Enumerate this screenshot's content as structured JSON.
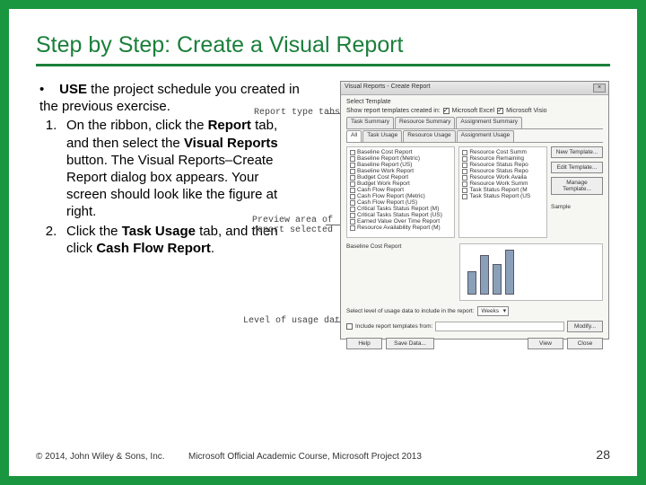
{
  "title": "Step by Step: Create a Visual Report",
  "use_line": {
    "bullet": "•",
    "emph": "USE",
    "rest": " the project schedule you created in the previous exercise."
  },
  "steps": [
    {
      "num": "1.",
      "parts": {
        "a": "On the ribbon, click the ",
        "b": "Report",
        "c": " tab, and then select the ",
        "d": "Visual Reports",
        "e": " button. The Visual Reports–Create Report dialog box appears. Your screen should look like the figure at right."
      }
    },
    {
      "num": "2.",
      "parts": {
        "a": "Click the ",
        "b": "Task Usage",
        "c": " tab, and then click ",
        "d": "Cash Flow Report",
        "e": "."
      }
    }
  ],
  "callouts": {
    "tabs": "Report type tabs",
    "preview": "Preview area of\nreport selected",
    "level": "Level of usage data"
  },
  "dialog": {
    "title": "Visual Reports - Create Report",
    "select_template": "Select Template",
    "show_line": "Show report templates created in:",
    "show_opts": [
      "Microsoft Excel",
      "Microsoft Visio"
    ],
    "tabs_row1": [
      "Task Summary",
      "Resource Summary",
      "Assignment Summary"
    ],
    "tabs_row2": [
      "All",
      "Task Usage",
      "Resource Usage",
      "Assignment Usage"
    ],
    "list_left": [
      "Baseline Cost Report",
      "Baseline Report (Metric)",
      "Baseline Report (US)",
      "Baseline Work Report",
      "Budget Cost Report",
      "Budget Work Report",
      "Cash Flow Report",
      "Cash Flow Report (Metric)",
      "Cash Flow Report (US)",
      "Critical Tasks Status Report (M)",
      "Critical Tasks Status Report (US)",
      "Earned Value Over Time Report",
      "Resource Availability Report (M)"
    ],
    "list_right": [
      "Resource Cost Summ",
      "Resource Remaining",
      "Resource Status Repo",
      "Resource Status Repo",
      "Resource Work Availa",
      "Resource Work Summ",
      "Task Status Report (M",
      "Task Status Report (US"
    ],
    "right_buttons": [
      "New Template...",
      "Edit Template...",
      "Manage Template..."
    ],
    "sample_label": "Sample",
    "preview_report_name": "Baseline Cost Report",
    "level_label": "Select level of usage data to include in the report:",
    "level_value": "Weeks",
    "include_label": "Include report templates from:",
    "modify_btn": "Modify...",
    "bottom_buttons": [
      "Help",
      "Save Data...",
      "View",
      "Close"
    ]
  },
  "footer": {
    "copyright": "© 2014, John Wiley & Sons, Inc.",
    "course": "Microsoft Official Academic Course, Microsoft Project 2013",
    "page": "28"
  }
}
